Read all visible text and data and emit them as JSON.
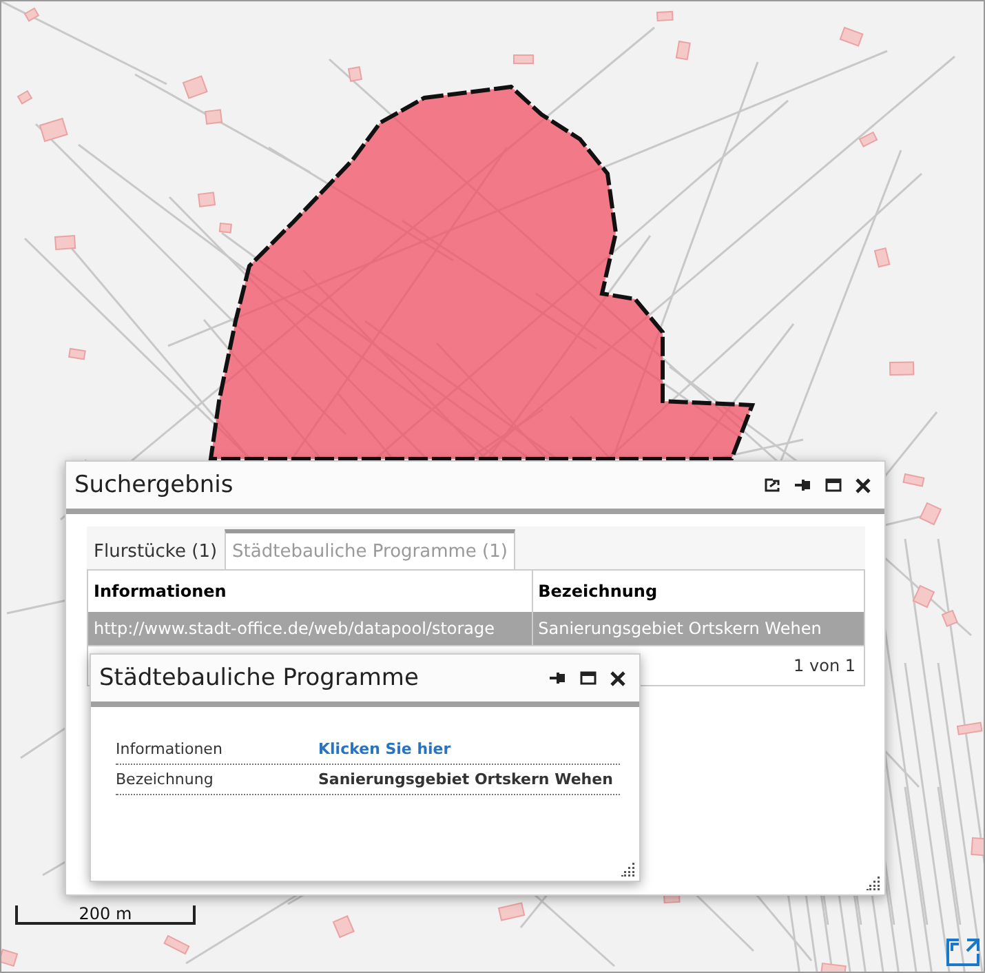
{
  "map": {
    "scale_label": "200 m"
  },
  "search_window": {
    "title": "Suchergebnis",
    "tabs": [
      {
        "label": "Flurstücke (1)",
        "selected": false
      },
      {
        "label": "Städtebauliche Programme (1)",
        "selected": true
      }
    ],
    "table": {
      "columns": [
        "Informationen",
        "Bezeichnung"
      ],
      "rows": [
        {
          "cells": [
            "http://www.stadt-office.de/web/datapool/storage",
            "Sanierungsgebiet Ortskern Wehen"
          ],
          "selected": true
        }
      ]
    },
    "pager": "1 von 1"
  },
  "detail_window": {
    "title": "Städtebauliche Programme",
    "rows": [
      {
        "label": "Informationen",
        "value": "Klicken Sie hier",
        "kind": "link"
      },
      {
        "label": "Bezeichnung",
        "value": "Sanierungsgebiet Ortskern Wehen",
        "kind": "text"
      }
    ]
  }
}
